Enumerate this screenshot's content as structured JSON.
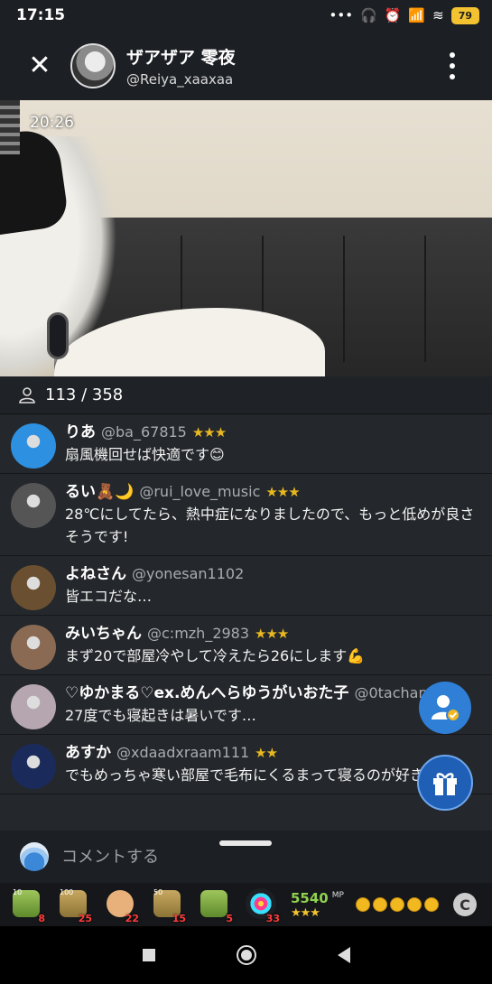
{
  "status": {
    "time": "17:15",
    "dots": "•••",
    "battery": "79"
  },
  "header": {
    "name": "ザアザア 零夜",
    "handle": "@Reiya_xaaxaa"
  },
  "video": {
    "timer": "20:26"
  },
  "viewers": {
    "count": "113 / 358"
  },
  "comments": [
    {
      "name": "りあ",
      "handle": "@ba_67815",
      "stars": "★★★",
      "text": "扇風機回せば快適です😊",
      "avatar_color": "#2e90e0"
    },
    {
      "name": "るい🧸🌙",
      "handle": "@rui_love_music",
      "stars": "★★★",
      "text": "28℃にしてたら、熱中症になりましたので、もっと低めが良さそうです!",
      "avatar_color": "#555555"
    },
    {
      "name": "よねさん",
      "handle": "@yonesan1102",
      "stars": "",
      "text": "皆エコだな…",
      "avatar_color": "#6a5030"
    },
    {
      "name": "みいちゃん",
      "handle": "@c:mzh_2983",
      "stars": "★★★",
      "text": "まず20で部屋冷やして冷えたら26にします💪",
      "avatar_color": "#8a6a52"
    },
    {
      "name": "♡ゆかまる♡ex.めんへらゆうがいおた子",
      "handle": "@0tachanman",
      "stars": "",
      "text": "27度でも寝起きは暑いです…",
      "avatar_color": "#b6a6b0"
    },
    {
      "name": "あすか",
      "handle": "@xdaadxraam111",
      "stars": "★★",
      "text": "でもめっちゃ寒い部屋で毛布にくるまって寝るのが好きです",
      "avatar_color": "#1a2a5a"
    }
  ],
  "comment_bar": {
    "placeholder": "コメントする"
  },
  "gifts": [
    {
      "label": "10",
      "count": "8",
      "kind": "tea-green"
    },
    {
      "label": "100",
      "count": "25",
      "kind": "tea"
    },
    {
      "label": "",
      "count": "22",
      "kind": "hands"
    },
    {
      "label": "50",
      "count": "15",
      "kind": "tea"
    },
    {
      "label": "",
      "count": "5",
      "kind": "tea-green"
    },
    {
      "label": "",
      "count": "33",
      "kind": "firework"
    }
  ],
  "mp": {
    "value": "5540",
    "unit": "MP",
    "stars": "★★★"
  },
  "c_badge": "C",
  "colors": {
    "accent_blue": "#2f7fd6",
    "star_gold": "#e8b820",
    "mp_green": "#8fd14f"
  }
}
